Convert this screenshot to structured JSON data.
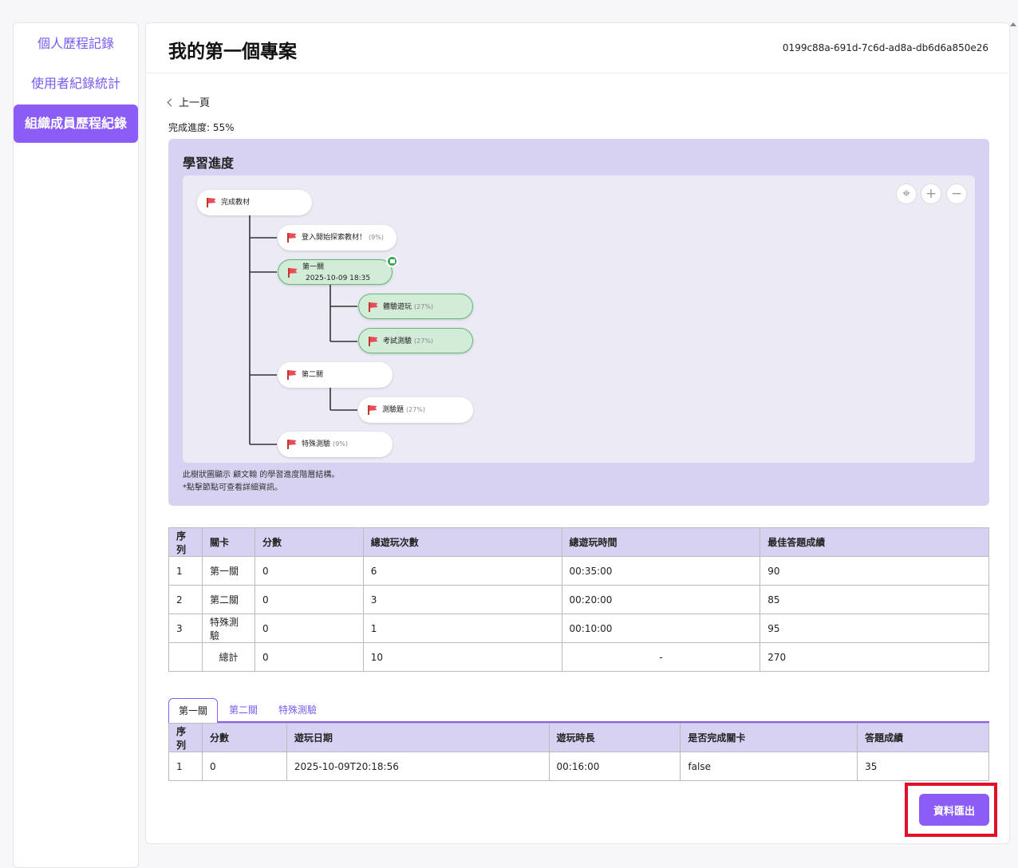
{
  "sidebar": {
    "items": [
      {
        "label": "個人歷程記錄"
      },
      {
        "label": "使用者紀錄統計"
      },
      {
        "label": "組織成員歷程紀錄"
      }
    ]
  },
  "header": {
    "title": "我的第一個專案",
    "project_id": "0199c88a-691d-7c6d-ad8a-db6d6a850e26"
  },
  "back_label": "上一頁",
  "progress_text": "完成進度: 55%",
  "learning_panel": {
    "title": "學習進度",
    "note1": "此樹狀圖顯示 顧文翰 的學習進度階層結構。",
    "note2": "*點擊節點可查看詳細資訊。",
    "controls": {
      "locate": "⌖",
      "zoom_in": "+",
      "zoom_out": "−"
    },
    "tree": {
      "root": "完成教材",
      "n1": {
        "label": "登入開始探索教材！",
        "pct": "(9%)"
      },
      "n2": {
        "label": "第一關",
        "date": "2025-10-09 18:35"
      },
      "n2a": {
        "label": "體驗遊玩",
        "pct": "(27%)"
      },
      "n2b": {
        "label": "考試測驗",
        "pct": "(27%)"
      },
      "n3": {
        "label": "第二關"
      },
      "n3a": {
        "label": "測驗題",
        "pct": "(27%)"
      },
      "n4": {
        "label": "特殊測驗",
        "pct": "(9%)"
      }
    }
  },
  "summary_table": {
    "headers": [
      "序列",
      "關卡",
      "分數",
      "總遊玩次數",
      "總遊玩時間",
      "最佳答題成績"
    ],
    "rows": [
      [
        "1",
        "第一關",
        "0",
        "6",
        "00:35:00",
        "90"
      ],
      [
        "2",
        "第二關",
        "0",
        "3",
        "00:20:00",
        "85"
      ],
      [
        "3",
        "特殊測驗",
        "0",
        "1",
        "00:10:00",
        "95"
      ]
    ],
    "total": [
      "",
      "總計",
      "0",
      "10",
      "-",
      "270"
    ]
  },
  "tabs": [
    {
      "label": "第一關"
    },
    {
      "label": "第二關"
    },
    {
      "label": "特殊測驗"
    }
  ],
  "detail_table": {
    "headers": [
      "序列",
      "分數",
      "遊玩日期",
      "遊玩時長",
      "是否完成關卡",
      "答題成績"
    ],
    "rows": [
      [
        "1",
        "0",
        "2025-10-09T20:18:56",
        "00:16:00",
        "false",
        "35"
      ]
    ]
  },
  "export_label": "資料匯出",
  "colors": {
    "accent": "#8b5cf6",
    "panel_bg": "#d8d2f2",
    "done_node": "#d2ecd8",
    "highlight_border": "#e3102a"
  }
}
